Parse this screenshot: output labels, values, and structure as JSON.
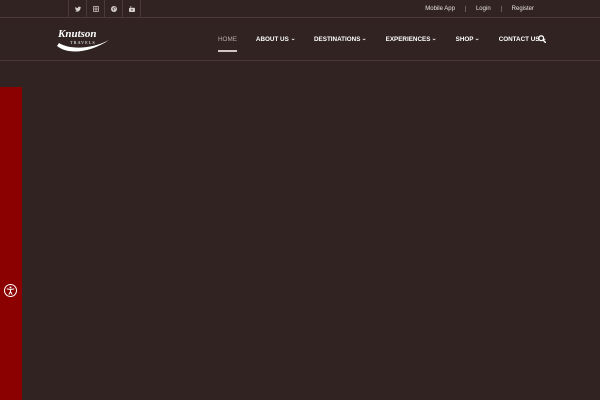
{
  "topbar": {
    "social_icons": [
      "twitter-icon",
      "instagram-icon",
      "pinterest-icon",
      "youtube-icon"
    ],
    "links": [
      "Mobile App",
      "Login",
      "Register"
    ]
  },
  "logo": {
    "name": "Knutson",
    "tagline": "TRAVELS"
  },
  "nav": {
    "items": [
      {
        "label": "HOME",
        "dropdown": false,
        "active": true
      },
      {
        "label": "ABOUT US",
        "dropdown": true
      },
      {
        "label": "DESTINATIONS",
        "dropdown": true
      },
      {
        "label": "EXPERIENCES",
        "dropdown": true
      },
      {
        "label": "SHOP",
        "dropdown": true
      },
      {
        "label": "CONTACT US",
        "dropdown": true
      }
    ],
    "search_icon": "search-icon"
  },
  "sidebar": {
    "accessibility_icon": "accessibility-icon"
  },
  "colors": {
    "background": "#302322",
    "accent_red": "#8b0000",
    "text": "#ffffff",
    "active_text": "#b8aeac"
  }
}
